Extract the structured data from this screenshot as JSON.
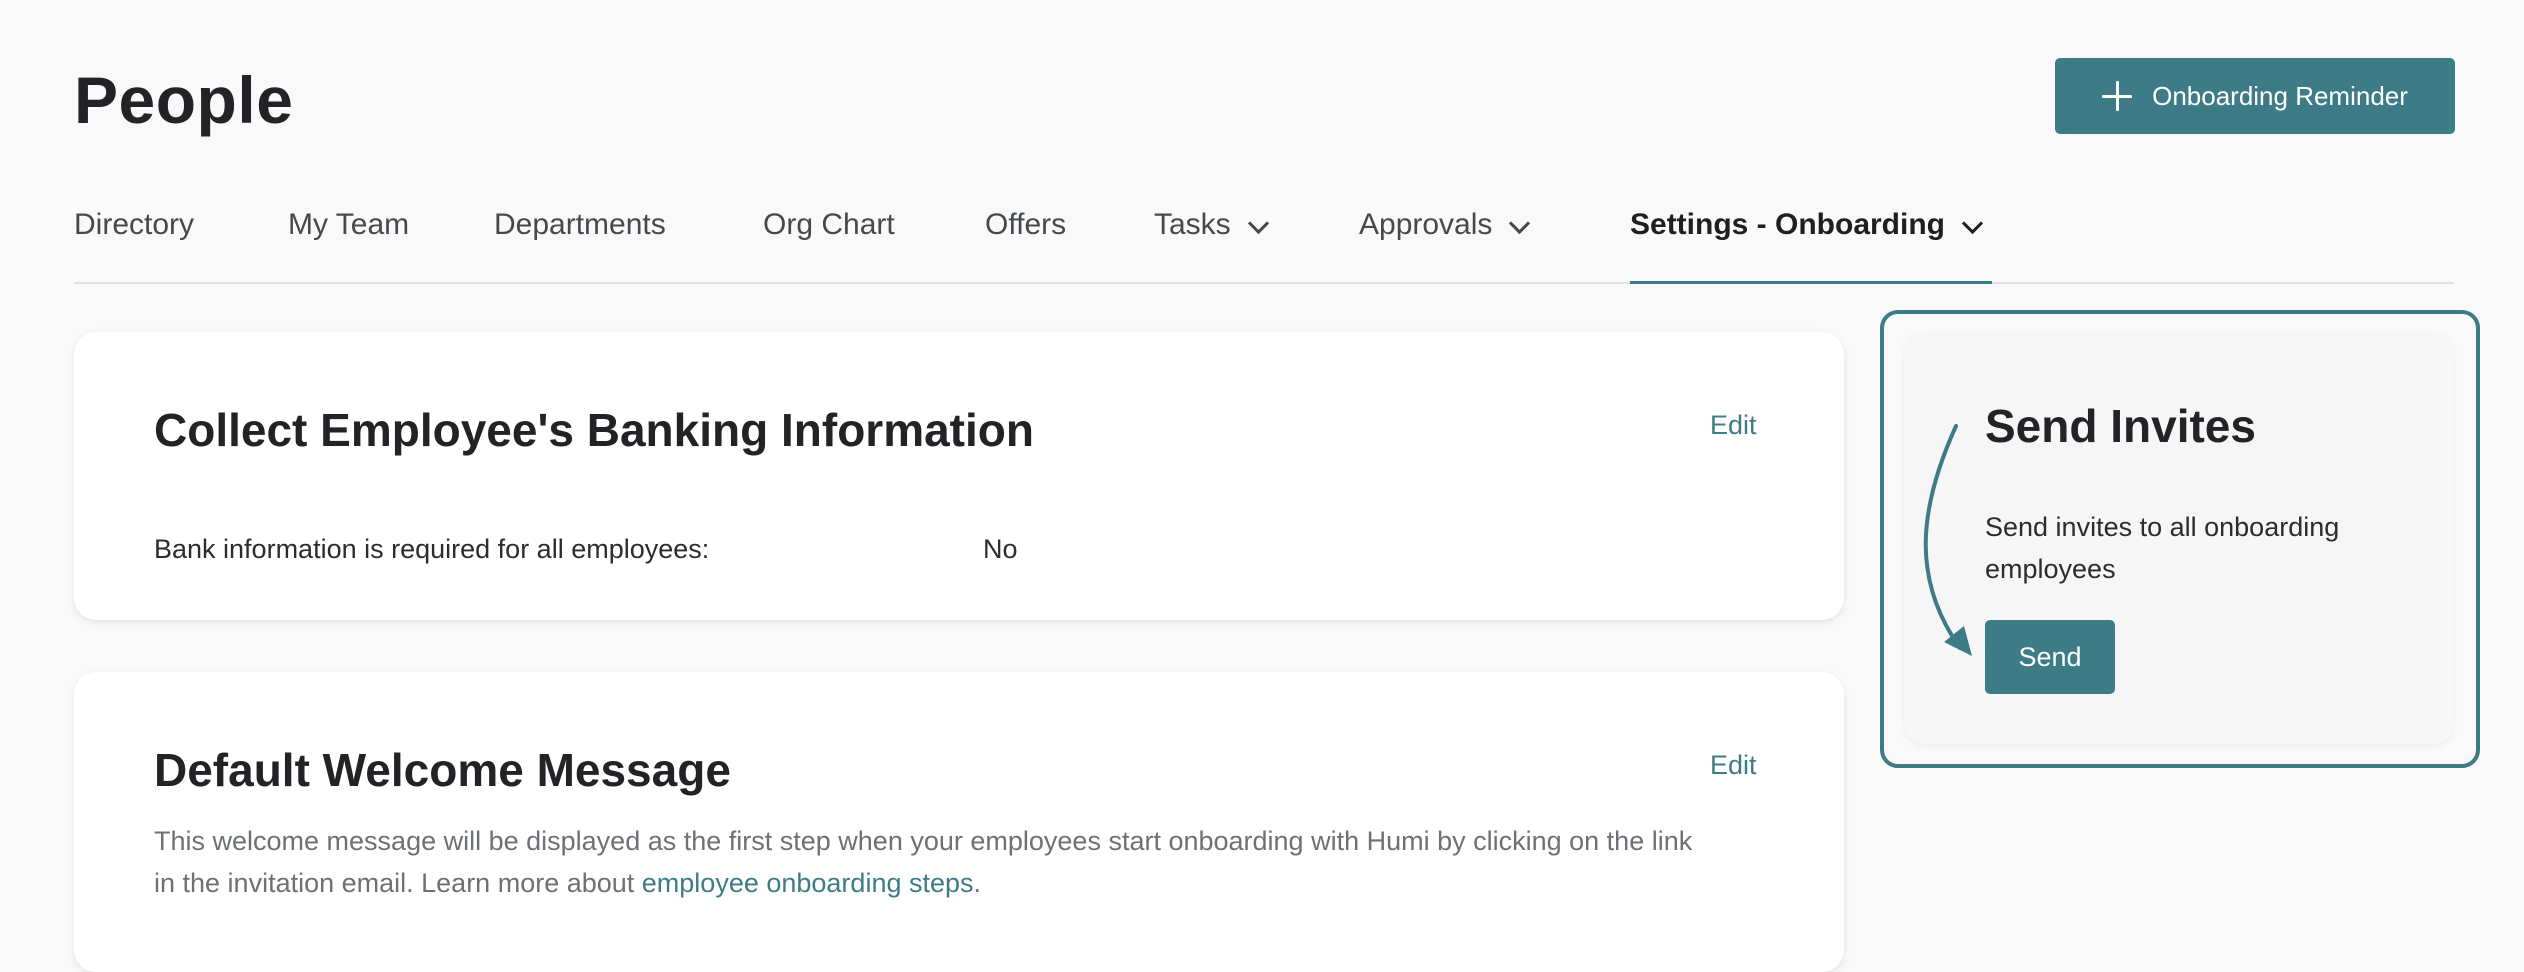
{
  "header": {
    "title": "People",
    "action_button": {
      "label": "Onboarding Reminder",
      "icon": "plus-icon"
    }
  },
  "tabs": [
    {
      "label": "Directory",
      "dropdown": false,
      "active": false
    },
    {
      "label": "My Team",
      "dropdown": false,
      "active": false
    },
    {
      "label": "Departments",
      "dropdown": false,
      "active": false
    },
    {
      "label": "Org Chart",
      "dropdown": false,
      "active": false
    },
    {
      "label": "Offers",
      "dropdown": false,
      "active": false
    },
    {
      "label": "Tasks",
      "dropdown": true,
      "active": false
    },
    {
      "label": "Approvals",
      "dropdown": true,
      "active": false
    },
    {
      "label": "Settings - Onboarding",
      "dropdown": true,
      "active": true
    }
  ],
  "banking_card": {
    "title": "Collect Employee's Banking Information",
    "edit_label": "Edit",
    "field_label": "Bank information is required for all employees:",
    "field_value": "No"
  },
  "welcome_card": {
    "title": "Default Welcome Message",
    "edit_label": "Edit",
    "description": "This welcome message will be displayed as the first step when your employees start onboarding with Humi by clicking on the link",
    "description_line2": "in the invitation email. Learn more about ",
    "link_text": "employee onboarding steps",
    "trailing": "."
  },
  "invites_card": {
    "title": "Send Invites",
    "description_line1": "Send invites to all onboarding",
    "description_line2": "employees",
    "button_label": "Send"
  },
  "colors": {
    "accent": "#3d7c87",
    "background": "#f9f9f9",
    "text": "#222326"
  }
}
